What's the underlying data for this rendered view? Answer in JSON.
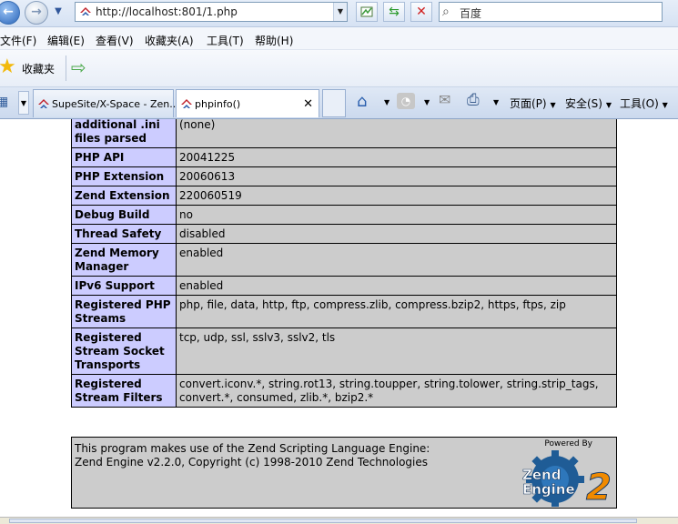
{
  "browser": {
    "address": "http://localhost:801/1.php",
    "search_placeholder": "百度",
    "menu": [
      "文件(F)",
      "编辑(E)",
      "查看(V)",
      "收藏夹(A)",
      "工具(T)",
      "帮助(H)"
    ],
    "favorites_label": "收藏夹",
    "tabs": [
      {
        "label": "SupeSite/X-Space - Zen..."
      },
      {
        "label": "phpinfo()"
      }
    ],
    "commands": {
      "page": "页面(P)",
      "safety": "安全(S)",
      "tools": "工具(O)"
    }
  },
  "phpinfo_rows": [
    {
      "key": "additional .ini files parsed",
      "value": "(none)"
    },
    {
      "key": "PHP API",
      "value": "20041225"
    },
    {
      "key": "PHP Extension",
      "value": "20060613"
    },
    {
      "key": "Zend Extension",
      "value": "220060519"
    },
    {
      "key": "Debug Build",
      "value": "no"
    },
    {
      "key": "Thread Safety",
      "value": "disabled"
    },
    {
      "key": "Zend Memory Manager",
      "value": "enabled"
    },
    {
      "key": "IPv6 Support",
      "value": "enabled"
    },
    {
      "key": "Registered PHP Streams",
      "value": "php, file, data, http, ftp, compress.zlib, compress.bzip2, https, ftps, zip"
    },
    {
      "key": "Registered Stream Socket Transports",
      "value": "tcp, udp, ssl, sslv3, sslv2, tls"
    },
    {
      "key": "Registered Stream Filters",
      "value": "convert.iconv.*, string.rot13, string.toupper, string.tolower, string.strip_tags, convert.*, consumed, zlib.*, bzip2.*"
    }
  ],
  "zend": {
    "line1": "This program makes use of the Zend Scripting Language Engine:",
    "line2": "Zend Engine v2.2.0, Copyright (c) 1998-2010 Zend Technologies",
    "powered_by": "Powered By",
    "logo_text_1": "Zend",
    "logo_text_2": "Engine",
    "logo_version": "2"
  }
}
